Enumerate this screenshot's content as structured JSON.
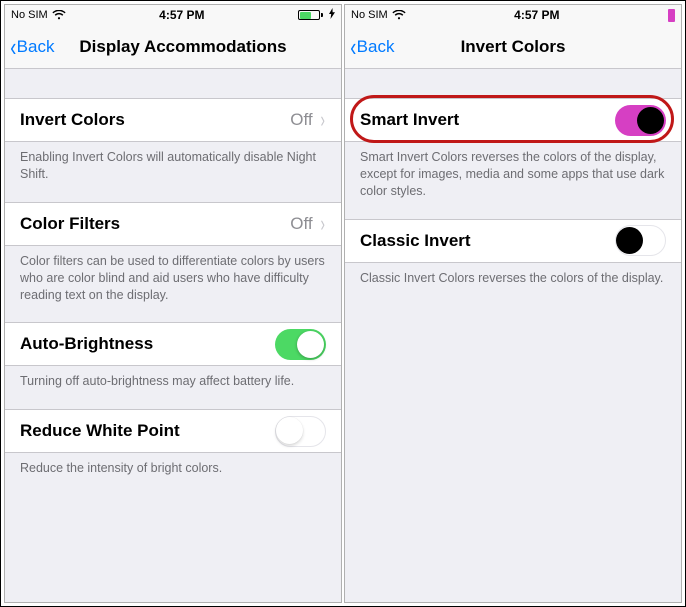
{
  "leftPhone": {
    "status": {
      "carrier": "No SIM",
      "time": "4:57 PM"
    },
    "nav": {
      "back": "Back",
      "title": "Display Accommodations"
    },
    "rows": {
      "invertColors": {
        "label": "Invert Colors",
        "status": "Off"
      },
      "invertColorsFooter": "Enabling Invert Colors will automatically disable Night Shift.",
      "colorFilters": {
        "label": "Color Filters",
        "status": "Off"
      },
      "colorFiltersFooter": "Color filters can be used to differentiate colors by users who are color blind and aid users who have difficulty reading text on the display.",
      "autoBrightness": {
        "label": "Auto-Brightness",
        "on": true
      },
      "autoBrightnessFooter": "Turning off auto-brightness may affect battery life.",
      "reduceWhitePoint": {
        "label": "Reduce White Point",
        "on": false
      },
      "reduceWhitePointFooter": "Reduce the intensity of bright colors."
    }
  },
  "rightPhone": {
    "status": {
      "carrier": "No SIM",
      "time": "4:57 PM"
    },
    "nav": {
      "back": "Back",
      "title": "Invert Colors"
    },
    "rows": {
      "smartInvert": {
        "label": "Smart Invert",
        "on": true
      },
      "smartInvertFooter": "Smart Invert Colors reverses the colors of the display, except for images, media and some apps that use dark color styles.",
      "classicInvert": {
        "label": "Classic Invert",
        "on": false
      },
      "classicInvertFooter": "Classic Invert Colors reverses the colors of the display."
    }
  }
}
